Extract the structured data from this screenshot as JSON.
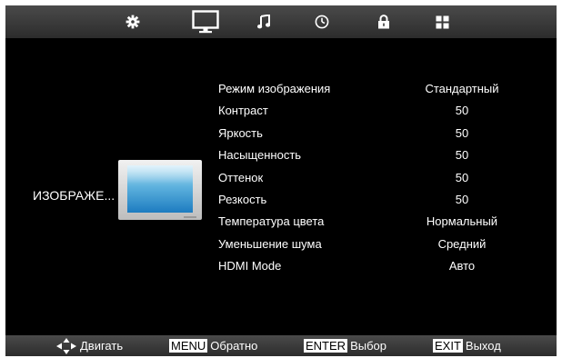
{
  "top_menu": {
    "tabs": [
      {
        "icon": "gear-icon",
        "name": "settings"
      },
      {
        "icon": "tv-monitor-icon",
        "name": "picture",
        "active": true
      },
      {
        "icon": "music-note-icon",
        "name": "sound"
      },
      {
        "icon": "clock-icon",
        "name": "time"
      },
      {
        "icon": "lock-icon",
        "name": "lock"
      },
      {
        "icon": "apps-grid-icon",
        "name": "apps"
      }
    ]
  },
  "category": {
    "label": "ИЗОБРАЖЕ...",
    "thumbnail_icon": "tv-picture-thumbnail"
  },
  "menu": {
    "items": [
      {
        "label": "Режим изображения",
        "value": "Стандартный"
      },
      {
        "label": "Контраст",
        "value": "50"
      },
      {
        "label": "Яркость",
        "value": "50"
      },
      {
        "label": "Насыщенность",
        "value": "50"
      },
      {
        "label": "Оттенок",
        "value": "50"
      },
      {
        "label": "Резкость",
        "value": "50"
      },
      {
        "label": "Температура цвета",
        "value": "Нормальный"
      },
      {
        "label": "Уменьшение шума",
        "value": "Средний"
      },
      {
        "label": "HDMI Mode",
        "value": "Авто"
      }
    ]
  },
  "hints": {
    "move": {
      "icon": "arrows-dpad-icon",
      "text": "Двигать"
    },
    "menu": {
      "key": "MENU",
      "text": "Обратно"
    },
    "enter": {
      "key": "ENTER",
      "text": "Выбор"
    },
    "exit": {
      "key": "EXIT",
      "text": "Выход"
    }
  },
  "colors": {
    "background": "#000000",
    "bar": "#3a3a3a",
    "text": "#ffffff",
    "thumb_screen": "#1d7cc0"
  }
}
